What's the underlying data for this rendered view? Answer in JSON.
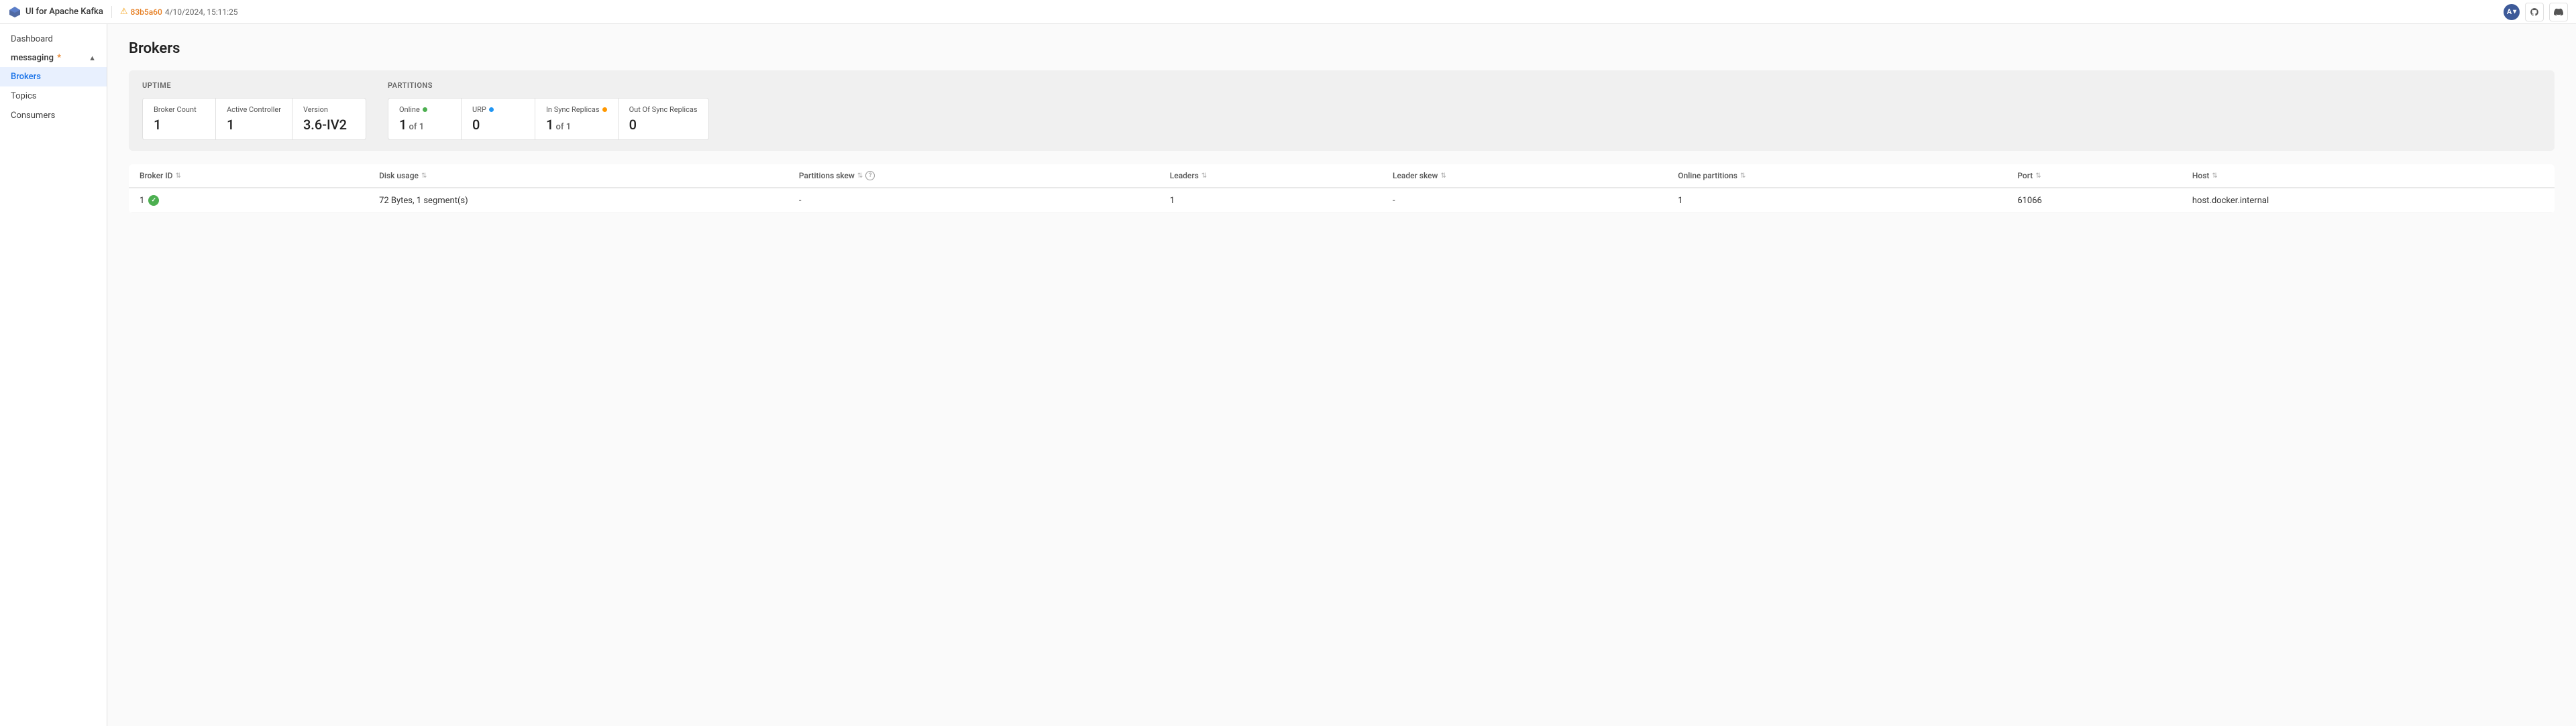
{
  "topbar": {
    "app_name": "UI for Apache Kafka",
    "alert_icon": "⚠",
    "commit": "83b5a60",
    "timestamp": "4/10/2024, 15:11:25",
    "avatar_label": "A"
  },
  "sidebar": {
    "dashboard_label": "Dashboard",
    "messaging_label": "messaging",
    "messaging_dot": "*",
    "items": [
      {
        "id": "brokers",
        "label": "Brokers",
        "active": true
      },
      {
        "id": "topics",
        "label": "Topics",
        "active": false
      },
      {
        "id": "consumers",
        "label": "Consumers",
        "active": false
      }
    ]
  },
  "page": {
    "title": "Brokers"
  },
  "stats": {
    "uptime_label": "Uptime",
    "partitions_label": "Partitions",
    "cards_uptime": [
      {
        "label": "Broker Count",
        "value": "1",
        "sub": "",
        "dot": ""
      },
      {
        "label": "Active Controller",
        "value": "1",
        "sub": "",
        "dot": ""
      },
      {
        "label": "Version",
        "value": "3.6-IV2",
        "sub": "",
        "dot": ""
      }
    ],
    "cards_partitions": [
      {
        "label": "Online",
        "value": "1",
        "sub": " of 1",
        "dot": "green"
      },
      {
        "label": "URP",
        "value": "0",
        "sub": "",
        "dot": "blue"
      },
      {
        "label": "In Sync Replicas",
        "value": "1",
        "sub": " of 1",
        "dot": "orange"
      },
      {
        "label": "Out Of Sync Replicas",
        "value": "0",
        "sub": "",
        "dot": ""
      }
    ]
  },
  "table": {
    "columns": [
      {
        "id": "broker-id",
        "label": "Broker ID",
        "sortable": true,
        "help": false
      },
      {
        "id": "disk-usage",
        "label": "Disk usage",
        "sortable": true,
        "help": false
      },
      {
        "id": "partitions-skew",
        "label": "Partitions skew",
        "sortable": true,
        "help": true
      },
      {
        "id": "leaders",
        "label": "Leaders",
        "sortable": true,
        "help": false
      },
      {
        "id": "leader-skew",
        "label": "Leader skew",
        "sortable": true,
        "help": false
      },
      {
        "id": "online-partitions",
        "label": "Online partitions",
        "sortable": true,
        "help": false
      },
      {
        "id": "port",
        "label": "Port",
        "sortable": true,
        "help": false
      },
      {
        "id": "host",
        "label": "Host",
        "sortable": true,
        "help": false
      }
    ],
    "rows": [
      {
        "broker_id": "1",
        "status": "online",
        "disk_usage": "72 Bytes, 1 segment(s)",
        "partitions_skew": "-",
        "leaders": "1",
        "leader_skew": "-",
        "online_partitions": "1",
        "port": "61066",
        "host": "host.docker.internal"
      }
    ]
  }
}
